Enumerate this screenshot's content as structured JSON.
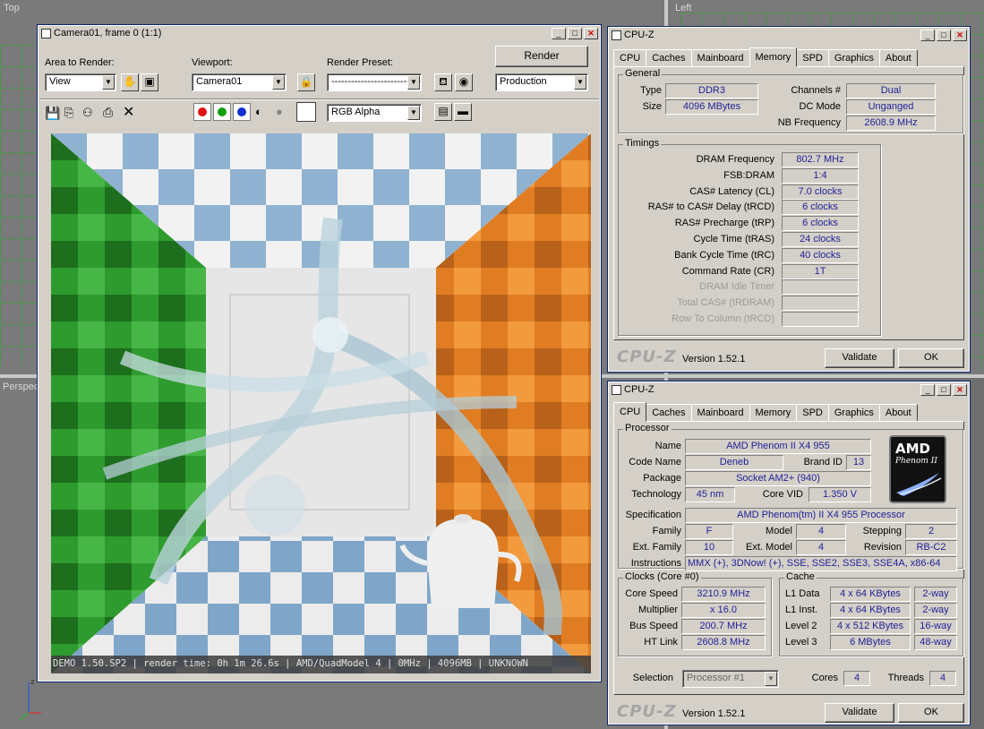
{
  "viewports": {
    "top_label": "Top",
    "left_label": "Left",
    "persp_label": "Perspec"
  },
  "render_window": {
    "title": "Camera01, frame 0 (1:1)",
    "area_label": "Area to Render:",
    "area_value": "View",
    "viewport_label": "Viewport:",
    "viewport_value": "Camera01",
    "preset_label": "Render Preset:",
    "preset_value": "----------------------------",
    "render_button": "Render",
    "production_value": "Production",
    "channel_value": "RGB Alpha",
    "status_text": "DEMO 1.50.SP2 | render time: 0h 1m 26.6s | AMD/QuadModel 4 | 0MHz | 4096MB | UNKNOWN"
  },
  "cpuz_memory": {
    "title": "CPU-Z",
    "tabs": [
      "CPU",
      "Caches",
      "Mainboard",
      "Memory",
      "SPD",
      "Graphics",
      "About"
    ],
    "active_tab": "Memory",
    "general_title": "General",
    "type_label": "Type",
    "type_value": "DDR3",
    "size_label": "Size",
    "size_value": "4096 MBytes",
    "channels_label": "Channels #",
    "channels_value": "Dual",
    "dcmode_label": "DC Mode",
    "dcmode_value": "Unganged",
    "nbfreq_label": "NB Frequency",
    "nbfreq_value": "2608.9 MHz",
    "timings_title": "Timings",
    "timings": [
      {
        "label": "DRAM Frequency",
        "value": "802.7 MHz",
        "enabled": true
      },
      {
        "label": "FSB:DRAM",
        "value": "1:4",
        "enabled": true
      },
      {
        "label": "CAS# Latency (CL)",
        "value": "7.0 clocks",
        "enabled": true
      },
      {
        "label": "RAS# to CAS# Delay (tRCD)",
        "value": "6 clocks",
        "enabled": true
      },
      {
        "label": "RAS# Precharge (tRP)",
        "value": "6 clocks",
        "enabled": true
      },
      {
        "label": "Cycle Time (tRAS)",
        "value": "24 clocks",
        "enabled": true
      },
      {
        "label": "Bank Cycle Time (tRC)",
        "value": "40 clocks",
        "enabled": true
      },
      {
        "label": "Command Rate (CR)",
        "value": "1T",
        "enabled": true
      },
      {
        "label": "DRAM Idle Timer",
        "value": "",
        "enabled": false
      },
      {
        "label": "Total CAS# (tRDRAM)",
        "value": "",
        "enabled": false
      },
      {
        "label": "Row To Column (tRCD)",
        "value": "",
        "enabled": false
      }
    ],
    "logo": "CPU-Z",
    "version": "Version 1.52.1",
    "validate_button": "Validate",
    "ok_button": "OK"
  },
  "cpuz_cpu": {
    "title": "CPU-Z",
    "tabs": [
      "CPU",
      "Caches",
      "Mainboard",
      "Memory",
      "SPD",
      "Graphics",
      "About"
    ],
    "active_tab": "CPU",
    "processor_title": "Processor",
    "name_label": "Name",
    "name_value": "AMD Phenom II X4 955",
    "codename_label": "Code Name",
    "codename_value": "Deneb",
    "brandid_label": "Brand ID",
    "brandid_value": "13",
    "package_label": "Package",
    "package_value": "Socket AM2+ (940)",
    "tech_label": "Technology",
    "tech_value": "45 nm",
    "corevid_label": "Core VID",
    "corevid_value": "1.350 V",
    "spec_label": "Specification",
    "spec_value": "AMD Phenom(tm) II X4 955 Processor",
    "family_label": "Family",
    "family_value": "F",
    "model_label": "Model",
    "model_value": "4",
    "stepping_label": "Stepping",
    "stepping_value": "2",
    "extfamily_label": "Ext. Family",
    "extfamily_value": "10",
    "extmodel_label": "Ext. Model",
    "extmodel_value": "4",
    "revision_label": "Revision",
    "revision_value": "RB-C2",
    "instr_label": "Instructions",
    "instr_value": "MMX (+), 3DNow! (+), SSE, SSE2, SSE3, SSE4A, x86-64",
    "amd_logo_top": "AMD",
    "amd_logo_bottom": "Phenom II",
    "clocks_title": "Clocks (Core #0)",
    "corespeed_label": "Core Speed",
    "corespeed_value": "3210.9 MHz",
    "multiplier_label": "Multiplier",
    "multiplier_value": "x 16.0",
    "busspeed_label": "Bus Speed",
    "busspeed_value": "200.7 MHz",
    "htlink_label": "HT Link",
    "htlink_value": "2608.8 MHz",
    "cache_title": "Cache",
    "cache": [
      {
        "label": "L1 Data",
        "size": "4 x 64 KBytes",
        "way": "2-way"
      },
      {
        "label": "L1 Inst.",
        "size": "4 x 64 KBytes",
        "way": "2-way"
      },
      {
        "label": "Level 2",
        "size": "4 x 512 KBytes",
        "way": "16-way"
      },
      {
        "label": "Level 3",
        "size": "6 MBytes",
        "way": "48-way"
      }
    ],
    "selection_label": "Selection",
    "selection_value": "Processor #1",
    "cores_label": "Cores",
    "cores_value": "4",
    "threads_label": "Threads",
    "threads_value": "4",
    "logo": "CPU-Z",
    "version": "Version 1.52.1",
    "validate_button": "Validate",
    "ok_button": "OK"
  }
}
